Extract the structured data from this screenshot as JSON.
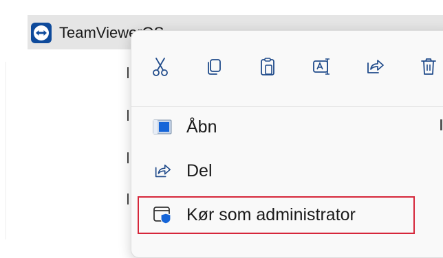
{
  "explorer": {
    "app_name": "TeamViewerOS",
    "app_icon": "teamviewer-icon",
    "accent": "#0e4a9b"
  },
  "context_menu": {
    "toolbar": [
      {
        "name": "cut-icon",
        "label": "Cut"
      },
      {
        "name": "copy-icon",
        "label": "Copy"
      },
      {
        "name": "paste-icon",
        "label": "Paste"
      },
      {
        "name": "rename-icon",
        "label": "Rename"
      },
      {
        "name": "share-icon",
        "label": "Share"
      },
      {
        "name": "delete-icon",
        "label": "Delete"
      }
    ],
    "items": [
      {
        "label": "Åbn",
        "icon": "open-app-icon"
      },
      {
        "label": "Del",
        "icon": "share-icon"
      },
      {
        "label": "Kør som administrator",
        "icon": "shield-admin-icon"
      }
    ],
    "highlight_color": "#d6263a",
    "icon_color": "#1f4a8a"
  }
}
